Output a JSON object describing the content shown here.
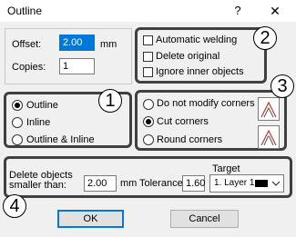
{
  "window": {
    "title": "Outline",
    "help_label": "?",
    "close_label": "✕"
  },
  "offset": {
    "label": "Offset:",
    "value": "2.00",
    "unit": "mm"
  },
  "copies": {
    "label": "Copies:",
    "value": "1"
  },
  "options": {
    "automatic_welding": {
      "label": "Automatic welding",
      "checked": false
    },
    "delete_original": {
      "label": "Delete original",
      "checked": false
    },
    "ignore_inner": {
      "label": "Ignore inner objects",
      "checked": false
    }
  },
  "outline_type": {
    "selected": "Outline",
    "items": [
      "Outline",
      "Inline",
      "Outline & Inline"
    ]
  },
  "corners": {
    "selected": "Cut corners",
    "items": [
      "Do not modify corners",
      "Cut corners",
      "Round corners"
    ]
  },
  "bottom": {
    "delete_label_line1": "Delete objects",
    "delete_label_line2": "smaller than:",
    "delete_value": "2.00",
    "delete_unit": "mm",
    "tolerance_label": "Tolerance",
    "tolerance_value": "1.60",
    "target_label": "Target",
    "target_value": "1. Layer 1",
    "target_color": "#000000"
  },
  "buttons": {
    "ok": "OK",
    "cancel": "Cancel"
  },
  "badges": [
    "1",
    "2",
    "3",
    "4"
  ],
  "colors": {
    "highlight_border": "#404040",
    "default_button_border": "#0078d7"
  }
}
